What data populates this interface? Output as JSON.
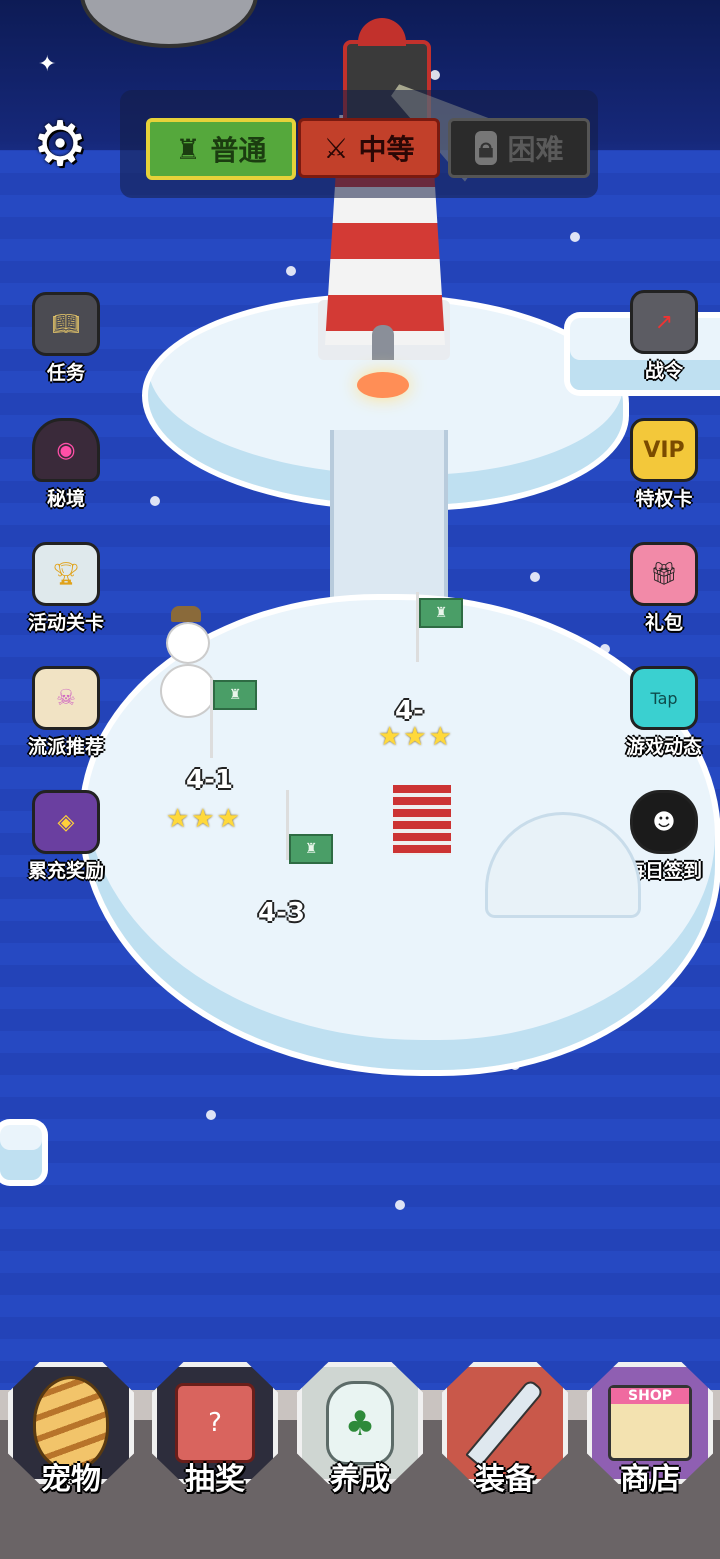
{
  "difficulty": {
    "normal": "普通",
    "medium": "中等",
    "hard": "困难"
  },
  "left_menu": [
    {
      "label": "任务",
      "icon": "book-icon"
    },
    {
      "label": "秘境",
      "icon": "cave-icon"
    },
    {
      "label": "活动关卡",
      "icon": "trophy-icon"
    },
    {
      "label": "流派推荐",
      "icon": "scroll-icon"
    },
    {
      "label": "累充奖励",
      "icon": "treasure-chest-icon"
    }
  ],
  "right_menu": [
    {
      "label": "战令",
      "icon": "tv-icon"
    },
    {
      "label": "特权卡",
      "icon": "vip-icon",
      "badge": "VIP"
    },
    {
      "label": "礼包",
      "icon": "gift-icon"
    },
    {
      "label": "游戏动态",
      "icon": "tap-phone-icon",
      "badge": "Tap"
    },
    {
      "label": "每日签到",
      "icon": "monster-face-icon"
    }
  ],
  "levels": [
    {
      "label": "4-1",
      "stars": "★★★"
    },
    {
      "label": "4-",
      "stars": "★★★"
    },
    {
      "label": "4-3",
      "stars": ""
    }
  ],
  "bottom_nav": [
    {
      "label": "宠物",
      "icon": "egg-icon"
    },
    {
      "label": "抽奖",
      "icon": "lottery-box-icon"
    },
    {
      "label": "养成",
      "icon": "potion-bottle-icon"
    },
    {
      "label": "装备",
      "icon": "sword-icon"
    },
    {
      "label": "商店",
      "icon": "shop-icon",
      "badge": "SHOP"
    }
  ],
  "colors": {
    "sea": "#2343b8",
    "normal_btn": "#55a83c",
    "medium_btn": "#c2402a",
    "hard_btn": "#2b2b2b"
  }
}
